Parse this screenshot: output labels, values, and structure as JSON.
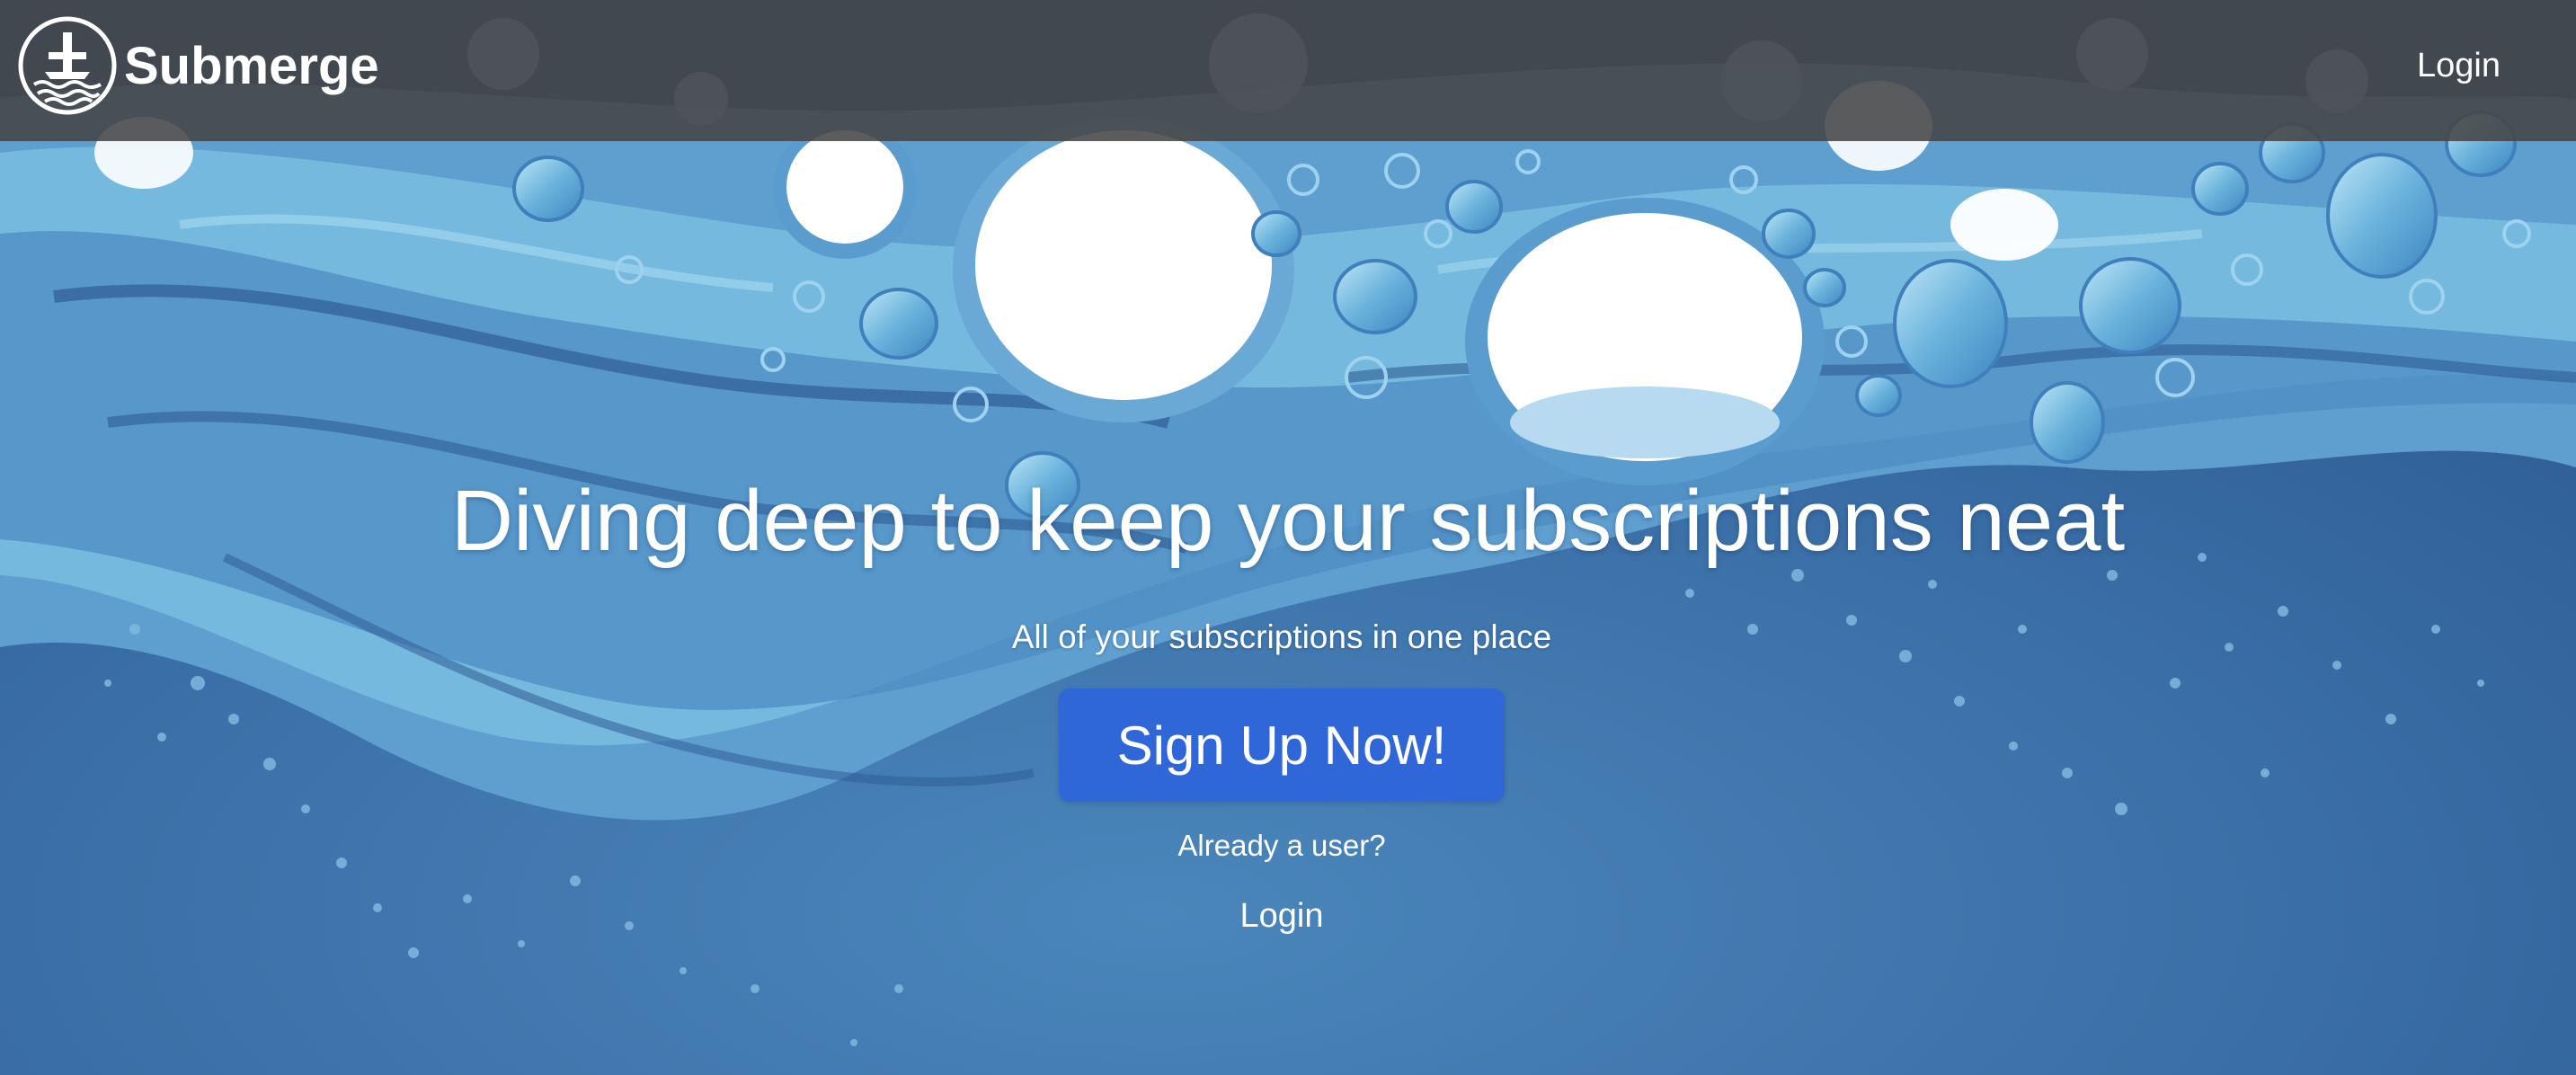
{
  "colors": {
    "navbar_bg": "#464646",
    "page_bg": "#35679f",
    "light_water": "#7fc0e0",
    "mid_water": "#4d8fc4",
    "deep_water": "#2f5f98",
    "button_bg": "#2f66d8",
    "text": "#ffffff"
  },
  "navbar": {
    "brand_name": "Submerge",
    "brand_icon": "submarine-waves-logo-icon",
    "login_label": "Login"
  },
  "hero": {
    "title": "Diving deep to keep your subscriptions neat",
    "subtitle": "All of your subscriptions in one place",
    "signup_label": "Sign Up Now!",
    "already_user_text": "Already a user?",
    "login_label": "Login"
  },
  "background": {
    "description_icon": "underwater-bubbles-background"
  }
}
